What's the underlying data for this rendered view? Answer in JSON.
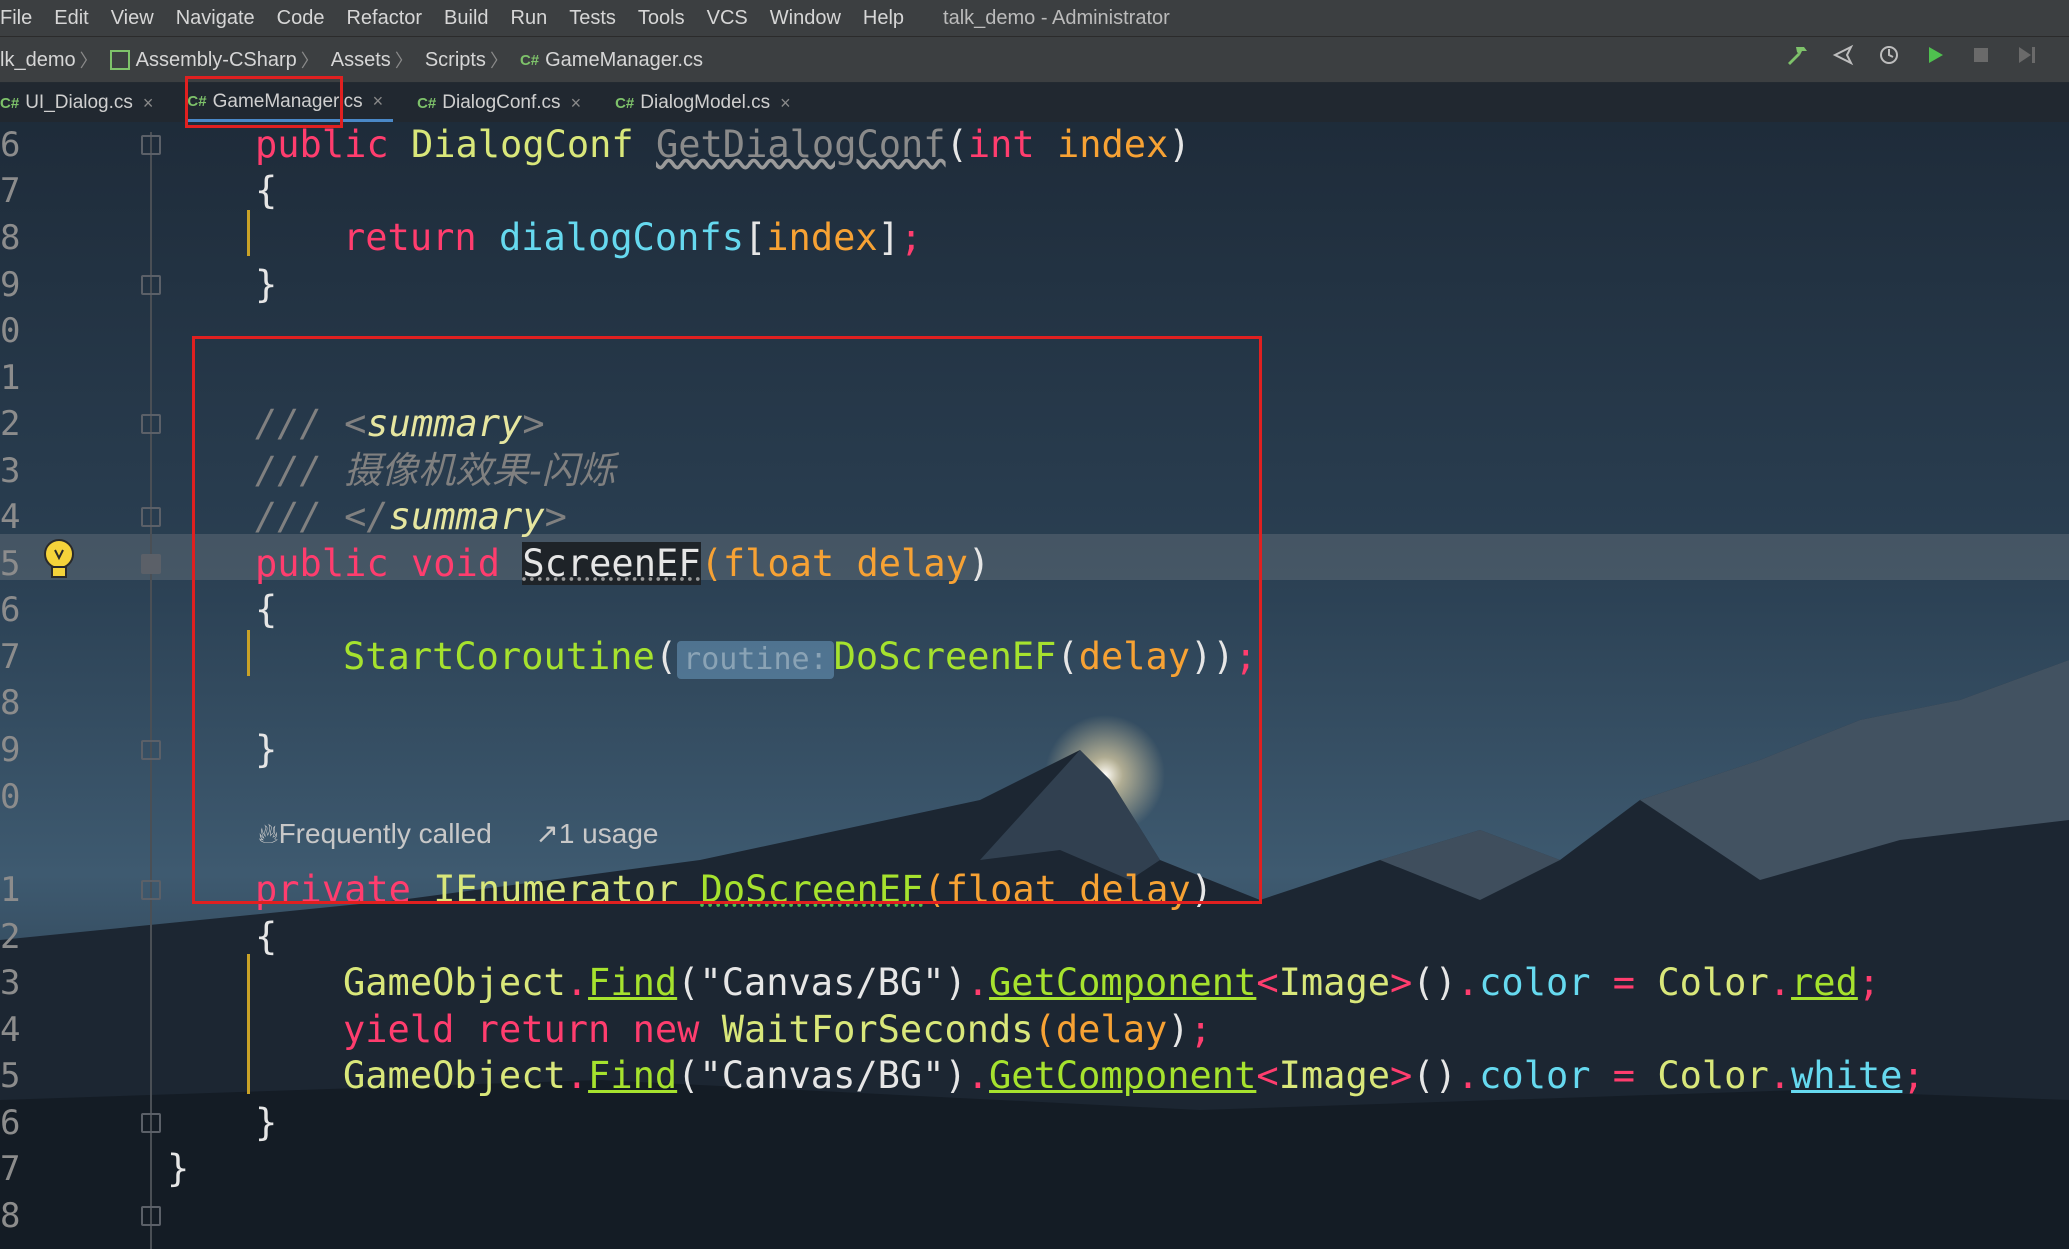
{
  "menu": [
    "File",
    "Edit",
    "View",
    "Navigate",
    "Code",
    "Refactor",
    "Build",
    "Run",
    "Tests",
    "Tools",
    "VCS",
    "Window",
    "Help"
  ],
  "window_title": "talk_demo - Administrator",
  "breadcrumb": {
    "project": "lk_demo",
    "assembly": "Assembly-CSharp",
    "folder1": "Assets",
    "folder2": "Scripts",
    "file": "GameManager.cs",
    "cs_glyph": "C#"
  },
  "tabs": [
    {
      "label": "UI_Dialog.cs",
      "close": "×"
    },
    {
      "label": "GameManager.cs",
      "close": "×"
    },
    {
      "label": "DialogConf.cs",
      "close": "×"
    },
    {
      "label": "DialogModel.cs",
      "close": "×"
    }
  ],
  "gutter": [
    "6",
    "7",
    "8",
    "9",
    "0",
    "1",
    "2",
    "3",
    "4",
    "5",
    "6",
    "7",
    "8",
    "9",
    "0",
    "1",
    "2",
    "3",
    "4",
    "5",
    "6",
    "7",
    "8"
  ],
  "code": {
    "l6": {
      "a": "public",
      "b": "DialogConf",
      "c": "GetDialogConf",
      "d": "(",
      "e": "int",
      "f": "index",
      ")": ")"
    },
    "l7": "{",
    "l8": {
      "a": "return",
      "b": "dialogConfs",
      "c": "[",
      "d": "index",
      "e": "]",
      "f": ";"
    },
    "l9": "}",
    "l12": {
      "a": "///",
      "b": "<",
      "c": "summary",
      "d": ">"
    },
    "l13": {
      "a": "///",
      "b": "摄像机效果-闪烁"
    },
    "l14": {
      "a": "///",
      "b": "</",
      "c": "summary",
      "d": ">"
    },
    "l15": {
      "a": "public",
      "b": "void",
      "c": "ScreenEF",
      "d": "(",
      "e": "float",
      "f": "delay",
      "g": ")"
    },
    "l16": "{",
    "l17": {
      "a": "StartCoroutine",
      "b": "(",
      "hint": "routine:",
      "c": "DoScreenEF",
      "d": "(",
      "e": "delay",
      "f": "))",
      "g": ";"
    },
    "l19": "}",
    "lens": {
      "called": "Frequently called",
      "usage": "1 usage"
    },
    "l21": {
      "a": "private",
      "b": "IEnumerator",
      "c": "DoScreenEF",
      "d": "(",
      "e": "float",
      "f": "delay",
      "g": ")"
    },
    "l22": "{",
    "l23": {
      "a": "GameObject",
      "b": ".",
      "c": "Find",
      "d": "(\"Canvas/BG\")",
      "e": ".",
      "f": "GetComponent",
      "g": "<",
      "h": "Image",
      "i": ">",
      "j": "()",
      "k": ".",
      "l": "color",
      "m": " = ",
      "n": "Color",
      "o": ".",
      "p": "red",
      "q": ";"
    },
    "l24": {
      "a": "yield",
      "b": "return",
      "c": "new",
      "d": "WaitForSeconds",
      "e": "(",
      "f": "delay",
      "g": ")",
      ";": ";"
    },
    "l25": {
      "a": "GameObject",
      "b": ".",
      "c": "Find",
      "d": "(\"Canvas/BG\")",
      "e": ".",
      "f": "GetComponent",
      "g": "<",
      "h": "Image",
      "i": ">",
      "j": "()",
      "k": ".",
      "l": "color",
      "m": " = ",
      "n": "Color",
      "o": ".",
      "p": "white",
      "q": ";"
    },
    "l26": "}",
    "l27": "}"
  },
  "icons": {
    "build": "hammer-icon",
    "debug": "debug-icon",
    "attach": "attach-icon",
    "run": "run-icon",
    "stop": "stop-icon",
    "step": "step-icon",
    "bulb": "lightbulb-icon",
    "fire": "flame-icon",
    "usage": "usage-link-icon"
  },
  "colors": {
    "highlight_box": "#e02020",
    "accent_tab": "#4a88c7"
  }
}
